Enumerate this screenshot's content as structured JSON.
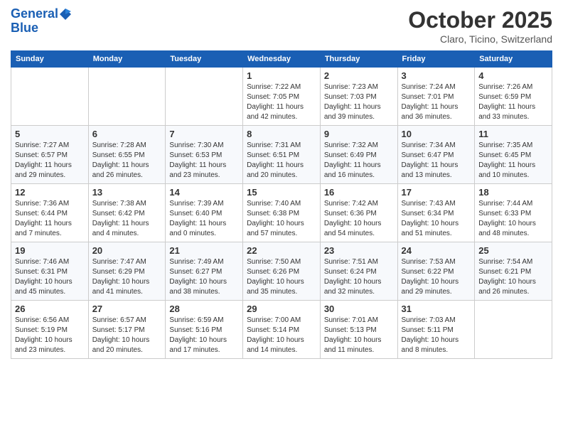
{
  "header": {
    "logo_line1": "General",
    "logo_line2": "Blue",
    "month": "October 2025",
    "location": "Claro, Ticino, Switzerland"
  },
  "weekdays": [
    "Sunday",
    "Monday",
    "Tuesday",
    "Wednesday",
    "Thursday",
    "Friday",
    "Saturday"
  ],
  "weeks": [
    [
      {
        "day": "",
        "info": ""
      },
      {
        "day": "",
        "info": ""
      },
      {
        "day": "",
        "info": ""
      },
      {
        "day": "1",
        "info": "Sunrise: 7:22 AM\nSunset: 7:05 PM\nDaylight: 11 hours\nand 42 minutes."
      },
      {
        "day": "2",
        "info": "Sunrise: 7:23 AM\nSunset: 7:03 PM\nDaylight: 11 hours\nand 39 minutes."
      },
      {
        "day": "3",
        "info": "Sunrise: 7:24 AM\nSunset: 7:01 PM\nDaylight: 11 hours\nand 36 minutes."
      },
      {
        "day": "4",
        "info": "Sunrise: 7:26 AM\nSunset: 6:59 PM\nDaylight: 11 hours\nand 33 minutes."
      }
    ],
    [
      {
        "day": "5",
        "info": "Sunrise: 7:27 AM\nSunset: 6:57 PM\nDaylight: 11 hours\nand 29 minutes."
      },
      {
        "day": "6",
        "info": "Sunrise: 7:28 AM\nSunset: 6:55 PM\nDaylight: 11 hours\nand 26 minutes."
      },
      {
        "day": "7",
        "info": "Sunrise: 7:30 AM\nSunset: 6:53 PM\nDaylight: 11 hours\nand 23 minutes."
      },
      {
        "day": "8",
        "info": "Sunrise: 7:31 AM\nSunset: 6:51 PM\nDaylight: 11 hours\nand 20 minutes."
      },
      {
        "day": "9",
        "info": "Sunrise: 7:32 AM\nSunset: 6:49 PM\nDaylight: 11 hours\nand 16 minutes."
      },
      {
        "day": "10",
        "info": "Sunrise: 7:34 AM\nSunset: 6:47 PM\nDaylight: 11 hours\nand 13 minutes."
      },
      {
        "day": "11",
        "info": "Sunrise: 7:35 AM\nSunset: 6:45 PM\nDaylight: 11 hours\nand 10 minutes."
      }
    ],
    [
      {
        "day": "12",
        "info": "Sunrise: 7:36 AM\nSunset: 6:44 PM\nDaylight: 11 hours\nand 7 minutes."
      },
      {
        "day": "13",
        "info": "Sunrise: 7:38 AM\nSunset: 6:42 PM\nDaylight: 11 hours\nand 4 minutes."
      },
      {
        "day": "14",
        "info": "Sunrise: 7:39 AM\nSunset: 6:40 PM\nDaylight: 11 hours\nand 0 minutes."
      },
      {
        "day": "15",
        "info": "Sunrise: 7:40 AM\nSunset: 6:38 PM\nDaylight: 10 hours\nand 57 minutes."
      },
      {
        "day": "16",
        "info": "Sunrise: 7:42 AM\nSunset: 6:36 PM\nDaylight: 10 hours\nand 54 minutes."
      },
      {
        "day": "17",
        "info": "Sunrise: 7:43 AM\nSunset: 6:34 PM\nDaylight: 10 hours\nand 51 minutes."
      },
      {
        "day": "18",
        "info": "Sunrise: 7:44 AM\nSunset: 6:33 PM\nDaylight: 10 hours\nand 48 minutes."
      }
    ],
    [
      {
        "day": "19",
        "info": "Sunrise: 7:46 AM\nSunset: 6:31 PM\nDaylight: 10 hours\nand 45 minutes."
      },
      {
        "day": "20",
        "info": "Sunrise: 7:47 AM\nSunset: 6:29 PM\nDaylight: 10 hours\nand 41 minutes."
      },
      {
        "day": "21",
        "info": "Sunrise: 7:49 AM\nSunset: 6:27 PM\nDaylight: 10 hours\nand 38 minutes."
      },
      {
        "day": "22",
        "info": "Sunrise: 7:50 AM\nSunset: 6:26 PM\nDaylight: 10 hours\nand 35 minutes."
      },
      {
        "day": "23",
        "info": "Sunrise: 7:51 AM\nSunset: 6:24 PM\nDaylight: 10 hours\nand 32 minutes."
      },
      {
        "day": "24",
        "info": "Sunrise: 7:53 AM\nSunset: 6:22 PM\nDaylight: 10 hours\nand 29 minutes."
      },
      {
        "day": "25",
        "info": "Sunrise: 7:54 AM\nSunset: 6:21 PM\nDaylight: 10 hours\nand 26 minutes."
      }
    ],
    [
      {
        "day": "26",
        "info": "Sunrise: 6:56 AM\nSunset: 5:19 PM\nDaylight: 10 hours\nand 23 minutes."
      },
      {
        "day": "27",
        "info": "Sunrise: 6:57 AM\nSunset: 5:17 PM\nDaylight: 10 hours\nand 20 minutes."
      },
      {
        "day": "28",
        "info": "Sunrise: 6:59 AM\nSunset: 5:16 PM\nDaylight: 10 hours\nand 17 minutes."
      },
      {
        "day": "29",
        "info": "Sunrise: 7:00 AM\nSunset: 5:14 PM\nDaylight: 10 hours\nand 14 minutes."
      },
      {
        "day": "30",
        "info": "Sunrise: 7:01 AM\nSunset: 5:13 PM\nDaylight: 10 hours\nand 11 minutes."
      },
      {
        "day": "31",
        "info": "Sunrise: 7:03 AM\nSunset: 5:11 PM\nDaylight: 10 hours\nand 8 minutes."
      },
      {
        "day": "",
        "info": ""
      }
    ]
  ]
}
